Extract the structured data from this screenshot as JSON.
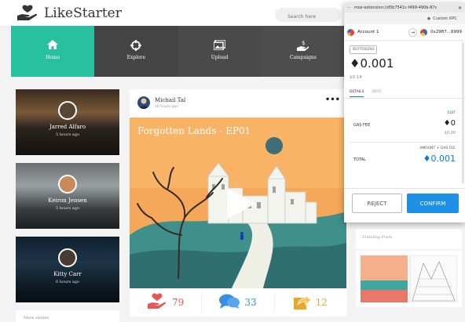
{
  "app": {
    "name": "LikeStarter",
    "search_placeholder": "Search here"
  },
  "nav": {
    "items": [
      {
        "label": "Home",
        "icon": "home-icon",
        "active": true
      },
      {
        "label": "Explore",
        "icon": "crosshair-icon",
        "active": false
      },
      {
        "label": "Upload",
        "icon": "upload-image-icon",
        "active": false
      },
      {
        "label": "Campaigns",
        "icon": "hand-money-icon",
        "active": false
      }
    ]
  },
  "stories": [
    {
      "name": "Jarred Alfaro",
      "time": "5 hours ago"
    },
    {
      "name": "Keiron Jensen",
      "time": "5 hours ago"
    },
    {
      "name": "Kitty Carr",
      "time": "6 hours ago"
    }
  ],
  "more_stories_label": "More stories",
  "post": {
    "author": "Michail Tal",
    "time": "16 hours ago",
    "title": "Forgotten Lands - EP01",
    "likes": "79",
    "comments": "33",
    "shares": "12"
  },
  "trending": {
    "title": "Trending Posts"
  },
  "metamask": {
    "url": "moz-extension://d5b7541c-f499-490b-87c",
    "network": "Custom RPC",
    "from_account": "Account 1",
    "to_account": "0x2987...6999",
    "badge": "BUYTOKENS",
    "amount": "0.001",
    "amount_usd": "$0.14",
    "tab_details": "DETAILS",
    "tab_data": "DATA",
    "edit": "EDIT",
    "gas_fee_label": "GAS FEE",
    "gas_fee_value": "0",
    "gas_fee_usd": "$0.00",
    "amount_gas_hint": "AMOUNT + GAS FEE",
    "total_label": "TOTAL",
    "total_value": "0.001",
    "reject": "REJECT",
    "confirm": "CONFIRM"
  },
  "colors": {
    "accent": "#27c0a0",
    "metamask_blue": "#037dd6",
    "like_red": "#e45757",
    "comment_blue": "#3a8de0",
    "share_orange": "#e8a82a"
  }
}
